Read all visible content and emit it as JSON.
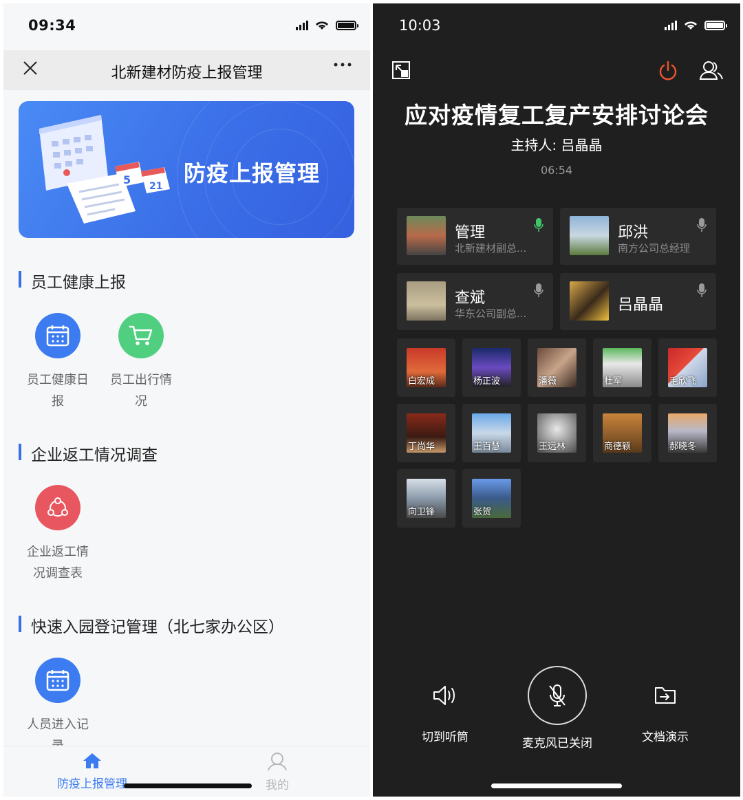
{
  "left": {
    "status_time": "09:34",
    "nav": {
      "title": "北新建材防疫上报管理",
      "close_icon": "close-icon",
      "more_icon": "more-icon"
    },
    "banner": {
      "title": "防疫上报管理"
    },
    "sections": [
      {
        "title": "员工健康上报"
      },
      {
        "title": "企业返工情况调查"
      },
      {
        "title": "快速入园登记管理（北七家办公区）"
      }
    ],
    "apps": [
      {
        "label_1": "员工健康日",
        "label_2": "报",
        "icon": "calendar-icon",
        "color": "#3d7cf0"
      },
      {
        "label_1": "员工出行情",
        "label_2": "况",
        "icon": "cart-icon",
        "color": "#4fcf7f"
      },
      {
        "label_1": "企业返工情",
        "label_2": "况调查表",
        "icon": "share-icon",
        "color": "#e8565f"
      },
      {
        "label_1": "人员进入记",
        "label_2": "录",
        "icon": "calendar-icon",
        "color": "#3d7cf0"
      }
    ],
    "tabs": [
      {
        "label": "防疫上报管理",
        "icon": "home-icon",
        "active": true,
        "color": "#3d7cf0"
      },
      {
        "label": "我的",
        "icon": "user-icon",
        "active": false,
        "color": "#b8b8b8"
      }
    ]
  },
  "right": {
    "status_time": "10:03",
    "meeting_title": "应对疫情复工复产安排讨论会",
    "host": "主持人: 吕晶晶",
    "timer": "06:54",
    "main_participants": [
      {
        "name": "管理",
        "subtitle": "北新建材副总...",
        "mic": "on",
        "mic_color": "#3fc36b"
      },
      {
        "name": "邱洪",
        "subtitle": "南方公司总经理",
        "mic": "idle",
        "mic_color": "#9a9a9a"
      },
      {
        "name": "查斌",
        "subtitle": "华东公司副总...",
        "mic": "idle",
        "mic_color": "#9a9a9a"
      },
      {
        "name": "吕晶晶",
        "subtitle": "",
        "mic": "idle",
        "mic_color": "#9a9a9a"
      }
    ],
    "participants": [
      {
        "name": "白宏成"
      },
      {
        "name": "杨正波"
      },
      {
        "name": "潘薇"
      },
      {
        "name": "杜军"
      },
      {
        "name": "毛欣飞"
      },
      {
        "name": "丁尚华"
      },
      {
        "name": "王百慧"
      },
      {
        "name": "王远林"
      },
      {
        "name": "商德颖"
      },
      {
        "name": "郝晓冬"
      },
      {
        "name": "向卫锋"
      },
      {
        "name": "张贺"
      }
    ],
    "controls": [
      {
        "label": "切到听筒",
        "icon": "speaker-icon"
      },
      {
        "label": "麦克风已关闭",
        "icon": "mic-off-icon"
      },
      {
        "label": "文档演示",
        "icon": "document-share-icon"
      }
    ],
    "accent_power": "#e8552f"
  }
}
